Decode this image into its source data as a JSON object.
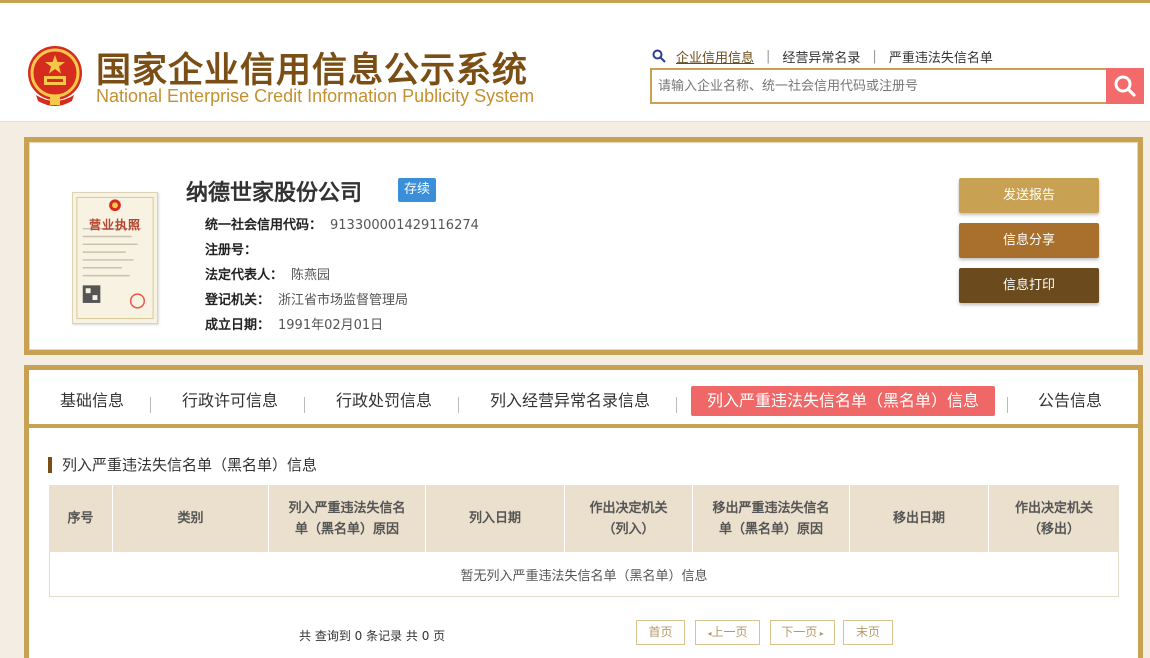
{
  "header": {
    "title_cn": "国家企业信用信息公示系统",
    "title_en": "National Enterprise Credit Information Publicity System",
    "nav": [
      {
        "label": "企业信用信息"
      },
      {
        "label": "经营异常名录"
      },
      {
        "label": "严重违法失信名单"
      }
    ],
    "search_placeholder": "请输入企业名称、统一社会信用代码或注册号"
  },
  "company": {
    "name": "纳德世家股份公司",
    "status": "存续",
    "license_label": "营业执照",
    "fields": [
      {
        "key": "统一社会信用代码：",
        "value": "913300001429116274"
      },
      {
        "key": "注册号：",
        "value": ""
      },
      {
        "key": "法定代表人：",
        "value": "陈燕园"
      },
      {
        "key": "登记机关：",
        "value": "浙江省市场监督管理局"
      },
      {
        "key": "成立日期：",
        "value": "1991年02月01日"
      }
    ],
    "actions": [
      {
        "label": "发送报告",
        "color": "#c9a153"
      },
      {
        "label": "信息分享",
        "color": "#a8702c"
      },
      {
        "label": "信息打印",
        "color": "#6b4a1e"
      }
    ]
  },
  "tabs": [
    {
      "label": "基础信息"
    },
    {
      "label": "行政许可信息"
    },
    {
      "label": "行政处罚信息"
    },
    {
      "label": "列入经营异常名录信息"
    },
    {
      "label": "列入严重违法失信名单（黑名单）信息"
    },
    {
      "label": "公告信息"
    }
  ],
  "section": {
    "title": "列入严重违法失信名单（黑名单）信息",
    "columns": [
      {
        "label": "序号"
      },
      {
        "label": "类别"
      },
      {
        "label": "列入严重违法失信名单（黑名单）原因"
      },
      {
        "label": "列入日期"
      },
      {
        "label": "作出决定机关（列入）"
      },
      {
        "label": "移出严重违法失信名单（黑名单）原因"
      },
      {
        "label": "移出日期"
      },
      {
        "label": "作出决定机关（移出）"
      }
    ],
    "empty_text": "暂无列入严重违法失信名单（黑名单）信息",
    "record_count": "共 查询到 0 条记录 共 0 页"
  },
  "pager": {
    "first": "首页",
    "prev": "上一页",
    "next": "下一页",
    "last": "末页"
  },
  "colors": {
    "brand_gold": "#c9a153",
    "brand_brown": "#7a4e14",
    "active_tab": "#f06767",
    "status_badge": "#3a8fd8",
    "search_button": "#f26a6a"
  }
}
